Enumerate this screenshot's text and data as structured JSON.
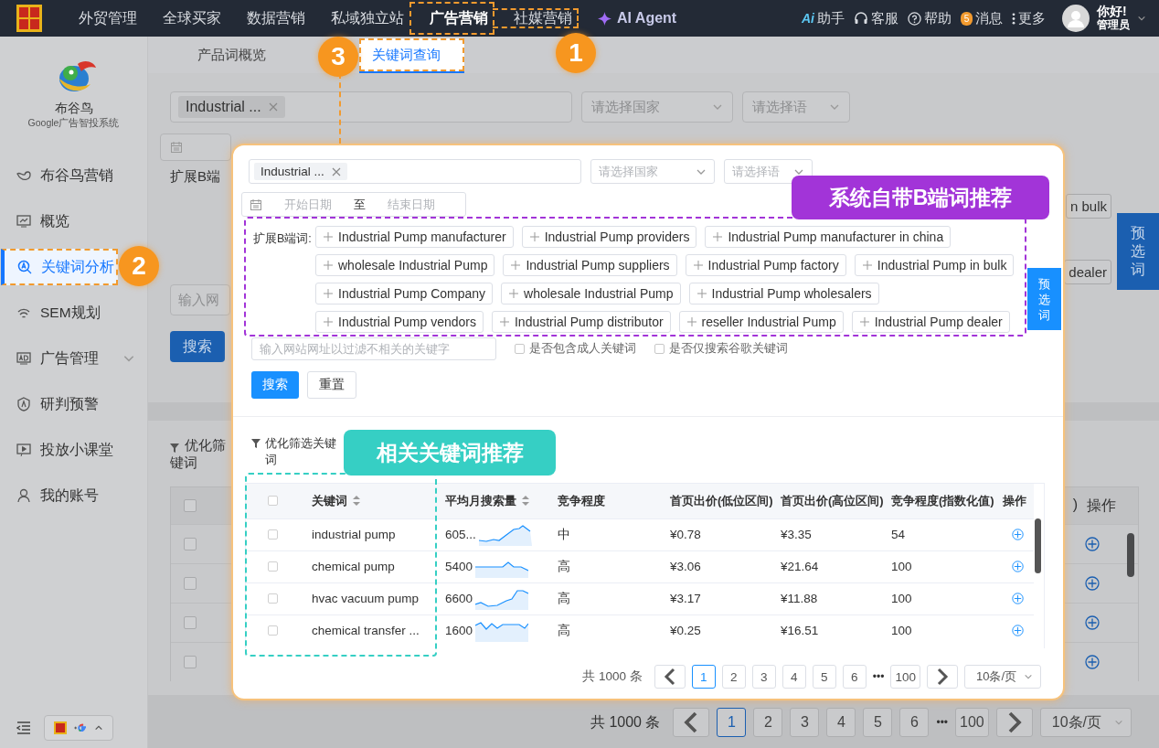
{
  "top_nav": {
    "items": [
      {
        "label": "外贸管理",
        "kind": "link",
        "selected": false
      },
      {
        "label": "全球买家",
        "kind": "link",
        "selected": false
      },
      {
        "label": "数据营销",
        "kind": "link",
        "selected": false
      },
      {
        "label": "私域独立站",
        "kind": "link",
        "selected": false
      },
      {
        "label": "广告营销",
        "kind": "link",
        "selected": true
      },
      {
        "label": "社媒营销",
        "kind": "link",
        "selected": false
      },
      {
        "label": "AI Agent",
        "kind": "ai",
        "selected": false
      }
    ],
    "tools": [
      {
        "kind": "ai",
        "icon_text": "Ai",
        "label": "助手"
      },
      {
        "kind": "headset",
        "label": "客服"
      },
      {
        "kind": "help",
        "label": "帮助"
      },
      {
        "kind": "message",
        "label": "消息",
        "badge": "5"
      },
      {
        "kind": "more",
        "label": "更多"
      }
    ],
    "user": {
      "greeting": "你好!",
      "role": "管理员"
    }
  },
  "sidebar": {
    "brand": {
      "name": "布谷鸟",
      "subtitle": "Google广告智投系统"
    },
    "items": [
      {
        "label": "布谷鸟营销",
        "kind": "link",
        "selected": false
      },
      {
        "label": "概览",
        "kind": "link",
        "selected": false
      },
      {
        "label": "关键词分析",
        "kind": "link",
        "selected": true
      },
      {
        "label": "SEM规划",
        "kind": "link",
        "selected": false
      },
      {
        "label": "广告管理",
        "kind": "group",
        "selected": false
      },
      {
        "label": "研判预警",
        "kind": "link",
        "selected": false
      },
      {
        "label": "投放小课堂",
        "kind": "link",
        "selected": false
      },
      {
        "label": "我的账号",
        "kind": "link",
        "selected": false
      }
    ]
  },
  "tabs": [
    {
      "label": "产品词概览",
      "selected": false
    },
    {
      "label": "关键词查询",
      "selected": true
    }
  ],
  "background_form": {
    "keyword_chip": "Industrial ...",
    "country_placeholder": "请选择国家",
    "language_placeholder": "请选择语",
    "expand_label": "扩展B端",
    "chip_fragments": [
      "n bulk",
      "dealer"
    ],
    "preselect_button": "预选词",
    "url_placeholder": "输入网",
    "search_button": "搜索"
  },
  "background_table": {
    "filter_label_top": "优化筛",
    "filter_label_bottom": "键词",
    "header_fragment": ")",
    "action_header": "操作",
    "header_checked": false,
    "rows": [
      {
        "checked": false
      },
      {
        "checked": false
      },
      {
        "checked": false
      },
      {
        "checked": false
      }
    ]
  },
  "background_pagination": {
    "total": "共 1000 条",
    "pages": [
      {
        "label": "1",
        "selected": true
      },
      {
        "label": "2",
        "selected": false
      },
      {
        "label": "3",
        "selected": false
      },
      {
        "label": "4",
        "selected": false
      },
      {
        "label": "5",
        "selected": false
      },
      {
        "label": "6",
        "selected": false
      }
    ],
    "ellipsis": "•••",
    "last": "100",
    "page_size": "10条/页"
  },
  "popup": {
    "keyword_chip": "Industrial ...",
    "country_placeholder": "请选择国家",
    "language_placeholder": "请选择语",
    "date_start": "开始日期",
    "date_separator": "至",
    "date_end": "结束日期",
    "expand_label": "扩展B端词:",
    "chip_rows": [
      [
        "Industrial Pump manufacturer",
        "Industrial Pump providers",
        "Industrial Pump manufacturer in china"
      ],
      [
        "wholesale Industrial Pump",
        "Industrial Pump suppliers",
        "Industrial Pump factory",
        "Industrial Pump in bulk"
      ],
      [
        "Industrial Pump Company",
        "wholesale Industrial Pump",
        "Industrial Pump wholesalers"
      ],
      [
        "Industrial Pump vendors",
        "Industrial Pump distributor",
        "reseller Industrial Pump",
        "Industrial Pump dealer"
      ]
    ],
    "preselect_button": "预选词",
    "url_placeholder": "输入网站网址以过滤不相关的关键字",
    "options": [
      {
        "label": "是否包含成人关键词",
        "checked": false
      },
      {
        "label": "是否仅搜索谷歌关键词",
        "checked": false
      }
    ],
    "buttons": [
      {
        "label": "搜索",
        "kind": "primary"
      },
      {
        "label": "重置",
        "kind": "default"
      }
    ],
    "filter_label": "优化筛选关键词",
    "table": {
      "header_checked": false,
      "columns": [
        {
          "label": "关键词",
          "sortable": true
        },
        {
          "label": "平均月搜索量",
          "sortable": true
        },
        {
          "label": "竞争程度",
          "sortable": false
        },
        {
          "label": "首页出价(低位区间)",
          "sortable": false
        },
        {
          "label": "首页出价(高位区间)",
          "sortable": false
        },
        {
          "label": "竞争程度(指数化值)",
          "sortable": false
        },
        {
          "label": "操作",
          "sortable": false
        }
      ],
      "rows": [
        {
          "checked": false,
          "keyword": "industrial pump",
          "volume": "605...",
          "competition": "中",
          "low_bid": "¥0.78",
          "high_bid": "¥3.35",
          "index": "54"
        },
        {
          "checked": false,
          "keyword": "chemical pump",
          "volume": "5400",
          "competition": "高",
          "low_bid": "¥3.06",
          "high_bid": "¥21.64",
          "index": "100"
        },
        {
          "checked": false,
          "keyword": "hvac vacuum pump",
          "volume": "6600",
          "competition": "高",
          "low_bid": "¥3.17",
          "high_bid": "¥11.88",
          "index": "100"
        },
        {
          "checked": false,
          "keyword": "chemical transfer ...",
          "volume": "1600",
          "competition": "高",
          "low_bid": "¥0.25",
          "high_bid": "¥16.51",
          "index": "100"
        }
      ]
    },
    "pagination": {
      "total": "共 1000 条",
      "pages": [
        {
          "label": "1",
          "selected": true
        },
        {
          "label": "2",
          "selected": false
        },
        {
          "label": "3",
          "selected": false
        },
        {
          "label": "4",
          "selected": false
        },
        {
          "label": "5",
          "selected": false
        },
        {
          "label": "6",
          "selected": false
        }
      ],
      "ellipsis": "•••",
      "last": "100",
      "page_size": "10条/页"
    }
  },
  "annotations": {
    "badges": [
      "1",
      "2",
      "3"
    ],
    "labels": [
      {
        "text": "系统自带B端词推荐",
        "color": "#a234d8"
      },
      {
        "text": "相关关键词推荐",
        "color": "#36cfc4"
      }
    ]
  }
}
